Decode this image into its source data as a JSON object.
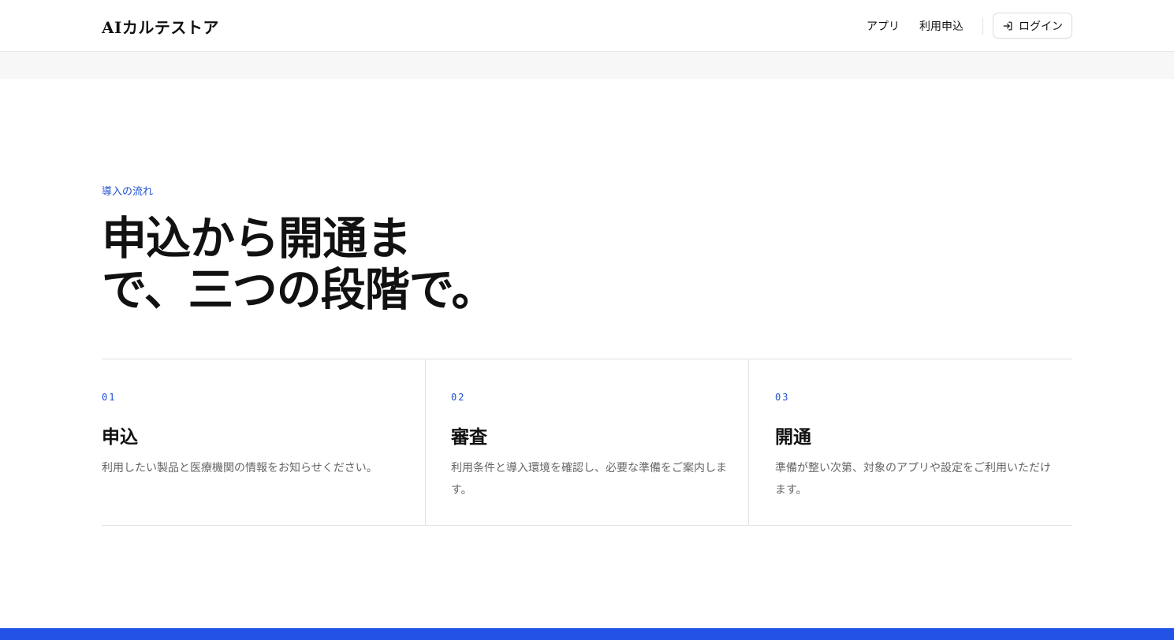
{
  "header": {
    "brand": "AIカルテストア",
    "nav": [
      {
        "label": "アプリ"
      },
      {
        "label": "利用申込"
      }
    ],
    "login_label": "ログイン",
    "login_icon": "login-icon"
  },
  "flow": {
    "section_label": "導入の流れ",
    "headline_lines": [
      "申込から開通ま",
      "で、三つの段階で。"
    ],
    "steps": [
      {
        "number": "01",
        "title": "申込",
        "description": "利用したい製品と医療機関の情報をお知らせください。"
      },
      {
        "number": "02",
        "title": "審査",
        "description": "利用条件と導入環境を確認し、必要な準備をご案内します。"
      },
      {
        "number": "03",
        "title": "開通",
        "description": "準備が整い次第、対象のアプリや設定をご利用いただけます。"
      }
    ]
  },
  "colors": {
    "accent": "#1f4fd1",
    "footer_band": "#2352e6",
    "muted_text": "#666666",
    "divider": "#e2e2e2"
  }
}
